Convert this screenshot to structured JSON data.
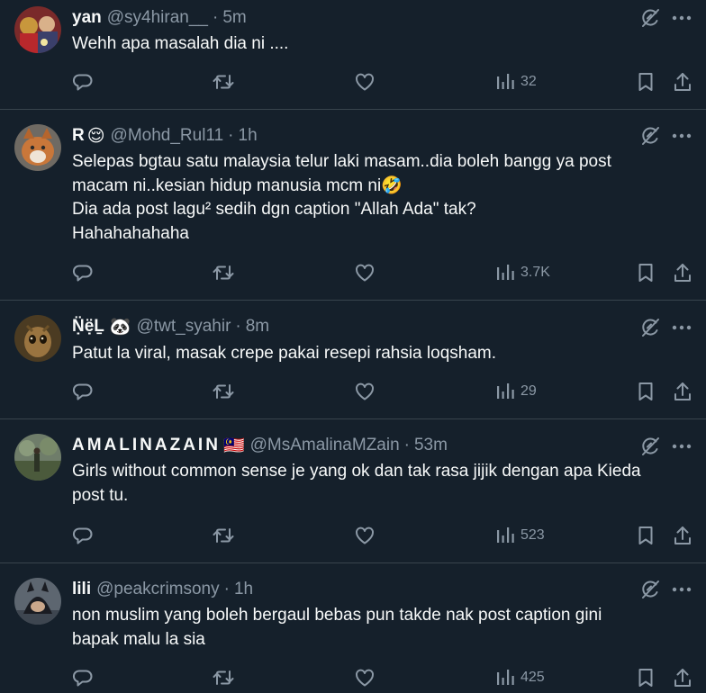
{
  "colors": {
    "background": "#15202b",
    "text": "#f7f9f9",
    "secondary": "#8b98a5",
    "divider": "#38444d"
  },
  "icons": {
    "reply": "reply-icon",
    "retweet": "retweet-icon",
    "like": "heart-icon",
    "views": "views-chart-icon",
    "bookmark": "bookmark-icon",
    "share": "share-icon",
    "grok": "grok-icon",
    "more": "more-icon"
  },
  "tweets": [
    {
      "name": "yan",
      "emoji": "",
      "handle": "@sy4hiran__",
      "separator": "·",
      "time": "5m",
      "lines": [
        "Wehh apa masalah dia ni ...."
      ],
      "views": "32"
    },
    {
      "name": "R",
      "emoji": "😌",
      "handle": "@Mohd_Rul11",
      "separator": "·",
      "time": "1h",
      "lines": [
        "Selepas bgtau satu malaysia telur laki masam..dia boleh bangg ya post",
        "macam ni..kesian hidup manusia mcm ni🤣",
        "Dia ada post lagu² sedih dgn caption \"Allah Ada\" tak?",
        "Hahahahahaha"
      ],
      "views": "3.7K"
    },
    {
      "name": "Ṇ̈ẹ̈Ḻ",
      "emoji": "🐼",
      "handle": "@twt_syahir",
      "separator": "·",
      "time": "8m",
      "lines": [
        "Patut la viral, masak crepe pakai resepi rahsia loqsham."
      ],
      "views": "29"
    },
    {
      "name": "AMALINAZAIN",
      "emoji": "🇲🇾",
      "handle": "@MsAmalinaMZain",
      "separator": "·",
      "time": "53m",
      "lines": [
        "Girls without common sense je yang ok dan tak rasa jijik dengan apa Kieda",
        "post tu."
      ],
      "views": "523"
    },
    {
      "name": "lili",
      "emoji": "",
      "handle": "@peakcrimsony",
      "separator": "·",
      "time": "1h",
      "lines": [
        "non muslim yang boleh bergaul bebas pun takde nak post caption gini",
        "bapak malu la sia"
      ],
      "views": "425"
    }
  ]
}
